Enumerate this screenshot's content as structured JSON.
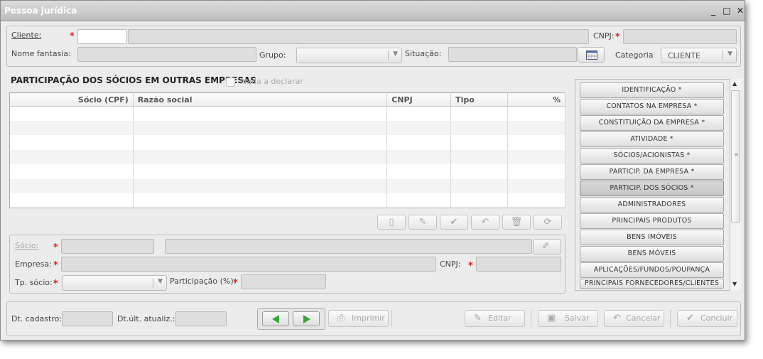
{
  "window": {
    "title": "Pessoa jurídica",
    "controls": [
      "_",
      "□",
      "✕"
    ]
  },
  "header": {
    "cliente_label": "Cliente:",
    "cnpj_label": "CNPJ:",
    "nome_fantasia_label": "Nome fantasia:",
    "grupo_label": "Grupo:",
    "situacao_label": "Situação:",
    "categoria_label": "Categoria",
    "categoria_value": "CLIENTE"
  },
  "section": {
    "title": "PARTICIPAÇÃO DOS SÓCIOS EM OUTRAS EMPRESAS",
    "nada_label": "Nada a declarar"
  },
  "table": {
    "columns": [
      "Sócio (CPF)",
      "Razão social",
      "CNPJ",
      "Tipo",
      "%"
    ]
  },
  "detail": {
    "socio_label": "Sócio:",
    "empresa_label": "Empresa:",
    "cnpj_label": "CNPJ:",
    "tp_socio_label": "Tp. sócio:",
    "participacao_label": "Participação (%):"
  },
  "nav": {
    "items": [
      "IDENTIFICAÇÃO *",
      "CONTATOS NA EMPRESA *",
      "CONSTITUIÇÃO DA EMPRESA *",
      "ATIVIDADE *",
      "SÓCIOS/ACIONISTAS *",
      "PARTICIP. DA EMPRESA *",
      "PARTICIP. DOS SÓCIOS *",
      "ADMINISTRADORES",
      "PRINCIPAIS PRODUTOS",
      "BENS IMÓVEIS",
      "BENS MÓVEIS",
      "APLICAÇÕES/FUNDOS/POUPANÇA",
      "PRINCIPAIS FORNECEDORES/CLIENTES"
    ],
    "active": "PARTICIP. DOS SÓCIOS *"
  },
  "footer": {
    "dt_cadastro_label": "Dt. cadastro:",
    "dt_atualiz_label": "Dt.últ. atualiz.:",
    "imprimir_label": "Imprimir",
    "editar_label": "Editar",
    "salvar_label": "Salvar",
    "cancelar_label": "Cancelar",
    "concluir_label": "Concluir"
  },
  "colors": {
    "required": "#dd2222",
    "nav_green": "#3aa63a"
  }
}
